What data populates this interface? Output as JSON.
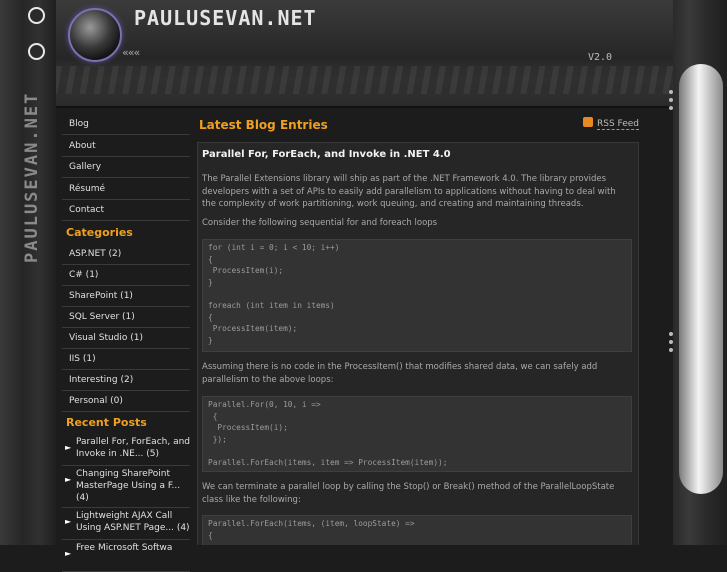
{
  "header": {
    "title": "PAULUSEVAN.NET",
    "chevrons": "«««",
    "version": "V2.0"
  },
  "side_logo": "PAULUSEVAN.NET",
  "nav": [
    "Blog",
    "About",
    "Gallery",
    "Résumé",
    "Contact"
  ],
  "categories": {
    "title": "Categories",
    "items": [
      "ASP.NET (2)",
      "C# (1)",
      "SharePoint (1)",
      "SQL Server (1)",
      "Visual Studio (1)",
      "IIS (1)",
      "Interesting (2)",
      "Personal (0)"
    ]
  },
  "recent": {
    "title": "Recent Posts",
    "items": [
      "Parallel For, ForEach, and Invoke in .NE... (5)",
      "Changing SharePoint MasterPage Using a F... (4)",
      "Lightweight AJAX Call Using ASP.NET Page... (4)",
      "Free Microsoft Softwa"
    ]
  },
  "main": {
    "title": "Latest Blog Entries",
    "rss": "RSS Feed",
    "post": {
      "title": "Parallel For, ForEach, and Invoke in .NET 4.0",
      "p1": "The Parallel Extensions library will ship as part of the .NET Framework 4.0. The library provides developers with a set of APIs to easily add parallelism to applications without having to deal with the complexity of work partitioning, work queuing, and creating and maintaining threads.",
      "p2": "Consider the following sequential for and foreach loops",
      "code1": "for (int i = 0; i < 10; i++)\n{\n ProcessItem(i);\n}\n\nforeach (int item in items)\n{\n ProcessItem(item);\n}",
      "p3": "Assuming there is no code in the ProcessItem() that modifies shared data, we can safely add parallelism to the above loops:",
      "code2": "Parallel.For(0, 10, i =>\n {\n  ProcessItem(i);\n });\n\nParallel.ForEach(items, item => ProcessItem(item));",
      "p4": "We can terminate a parallel loop by calling the Stop() or Break() method of the ParallelLoopState class like the following:",
      "code3": "Parallel.ForEach(items, (item, loopState) =>\n{"
    }
  }
}
